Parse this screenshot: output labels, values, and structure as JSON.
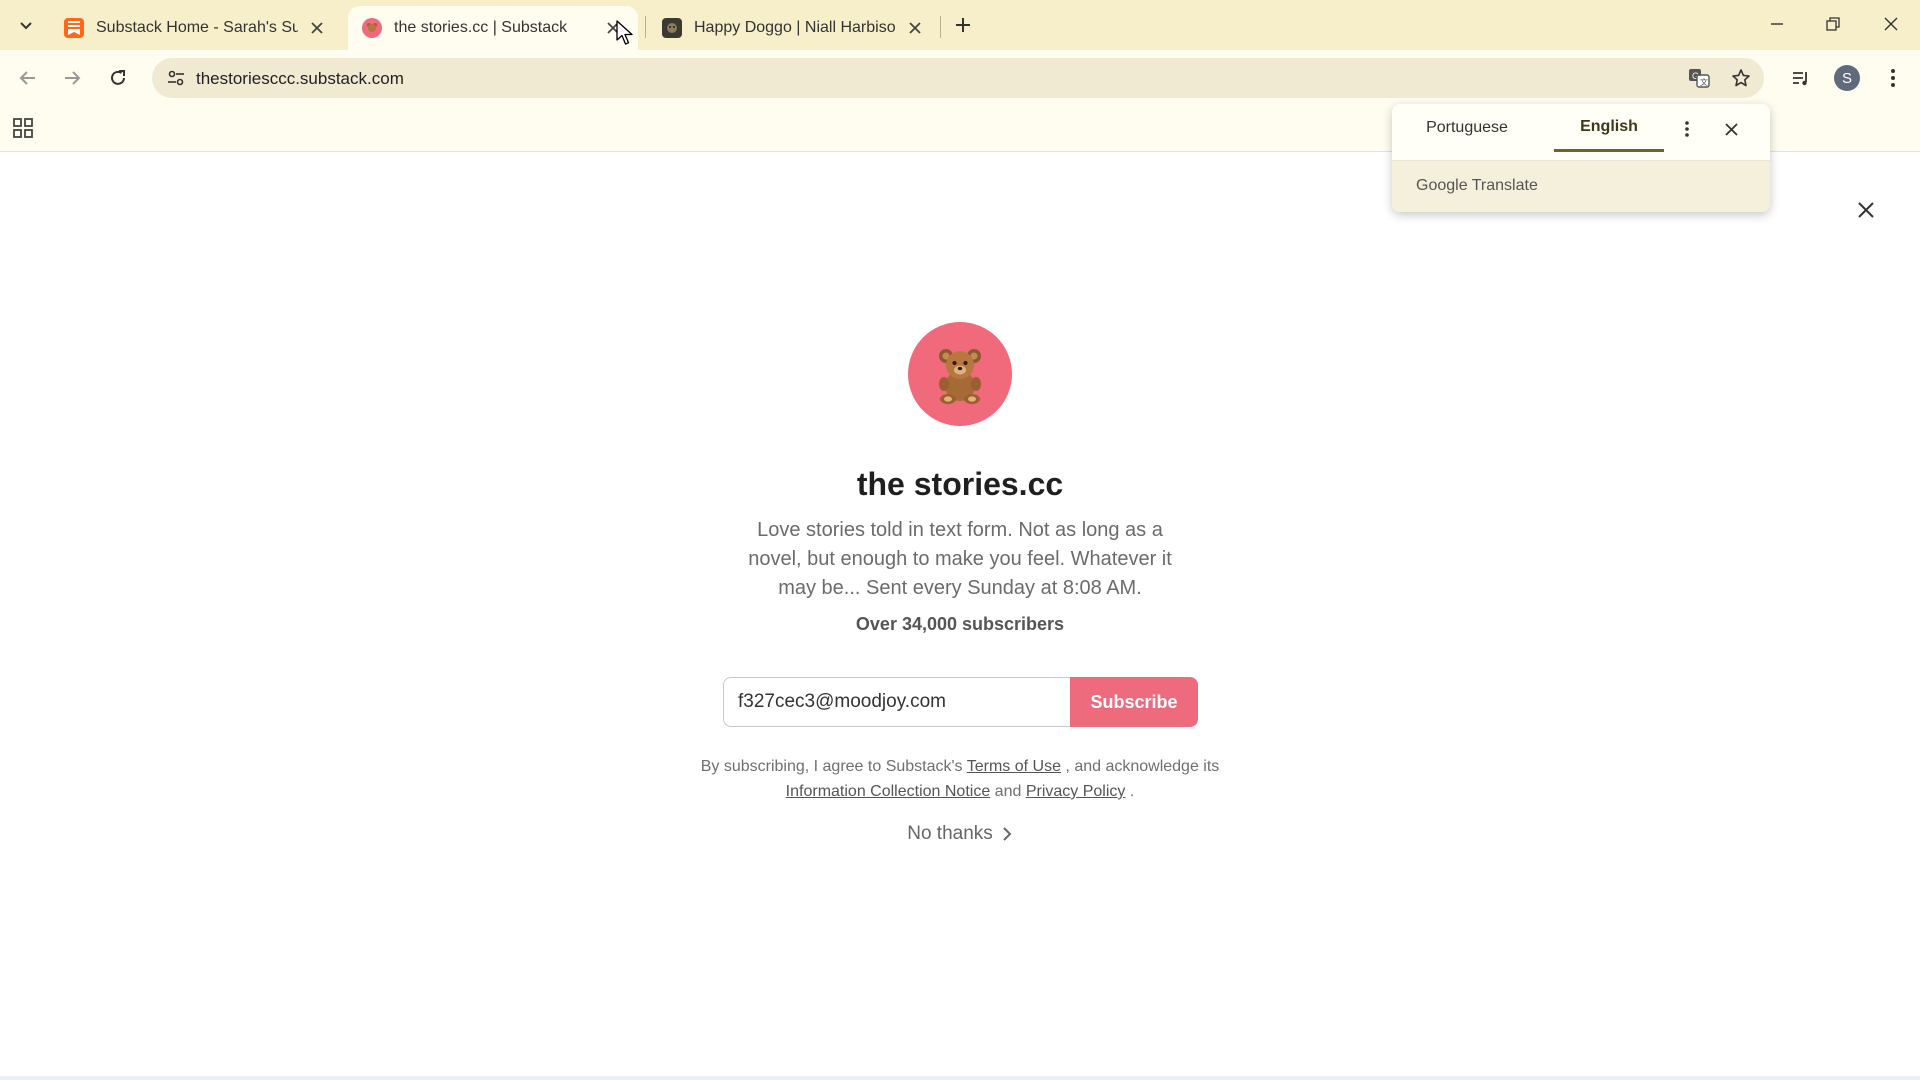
{
  "tabs": [
    {
      "title": "Substack Home - Sarah's Substack",
      "favicon": "substack-logo-icon",
      "active": false
    },
    {
      "title": "the stories.cc | Substack",
      "favicon": "teddy-bear-icon",
      "active": true
    },
    {
      "title": "Happy Doggo | Niall Harbison | Substack",
      "favicon": "dog-photo-icon",
      "active": false
    }
  ],
  "url": "thestoriesccc.substack.com",
  "translate": {
    "languages": [
      "Portuguese",
      "English"
    ],
    "selected": "English",
    "brand": "Google Translate"
  },
  "publication": {
    "title": "the stories.cc",
    "logo": "teddy-bear-icon",
    "description": "Love stories told in text form. Not as long as a novel, but enough to make you feel. Whatever it may be... Sent every Sunday at 8:08 AM.",
    "subscribers": "Over 34,000 subscribers"
  },
  "subscribe": {
    "email_value": "f327cec3@moodjoy.com",
    "button_label": "Subscribe"
  },
  "legal": {
    "part1": "By subscribing, I agree to Substack's",
    "terms": "Terms of Use",
    "part2": ", and acknowledge its",
    "info_notice": "Information Collection Notice",
    "part3": "and",
    "privacy": "Privacy Policy",
    "part4": "."
  },
  "no_thanks": "No thanks",
  "colors": {
    "brand_pink": "#ee6b7d",
    "chrome_frame": "#f6efca",
    "toolbar": "#fffdf0"
  }
}
